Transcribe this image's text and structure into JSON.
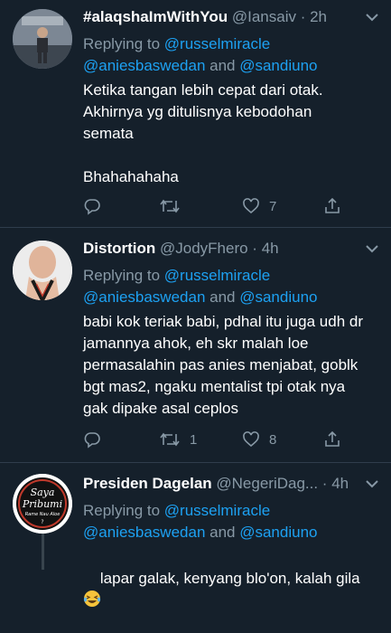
{
  "tweets": [
    {
      "display_name": "#alaqshaImWithYou",
      "handle_time": " @Iansaiv · 2h",
      "reply_prefix": "Replying to ",
      "reply_user1": "@russelmiracle",
      "reply_user2": "@aniesbaswedan",
      "reply_and": " and ",
      "reply_user3": "@sandiuno",
      "text": "Ketika tangan lebih cepat dari otak.\nAkhirnya yg ditulisnya kebodohan\nsemata\n\nBhahahahaha",
      "reply_count": "",
      "retweet_count": "",
      "like_count": "7"
    },
    {
      "display_name": "Distortion",
      "handle_time": " @JodyFhero · 4h",
      "reply_prefix": "Replying to ",
      "reply_user1": "@russelmiracle",
      "reply_user2": "@aniesbaswedan",
      "reply_and": " and ",
      "reply_user3": "@sandiuno",
      "text": "babi kok teriak babi, pdhal itu juga udh dr\njamannya ahok, eh skr malah loe\npermasalahin pas anies menjabat, goblk\nbgt mas2, ngaku mentalist tpi otak nya\ngak dipake asal ceplos",
      "reply_count": "",
      "retweet_count": "1",
      "like_count": "8"
    },
    {
      "display_name": "Presiden Dagelan",
      "handle_time": " @NegeriDag... · 4h",
      "reply_prefix": "Replying to ",
      "reply_user1": "@russelmiracle",
      "reply_user2": "@aniesbaswedan",
      "reply_and": " and ",
      "reply_user3": "@sandiuno",
      "text": "lapar galak, kenyang blo'on, kalah gila ",
      "avatar_text_line1": "Saya",
      "avatar_text_line2": "Pribumi",
      "avatar_text_line3": "Rame Nau Aloe",
      "avatar_text_line4": "?"
    }
  ],
  "colors": {
    "background": "#15202b",
    "secondary_text": "#8899a6",
    "link": "#1da1f2",
    "divider": "#2f3d4c"
  },
  "icons": [
    "reply-icon",
    "retweet-icon",
    "like-icon",
    "share-icon",
    "chevron-down-icon",
    "laughing-emoji-icon"
  ]
}
